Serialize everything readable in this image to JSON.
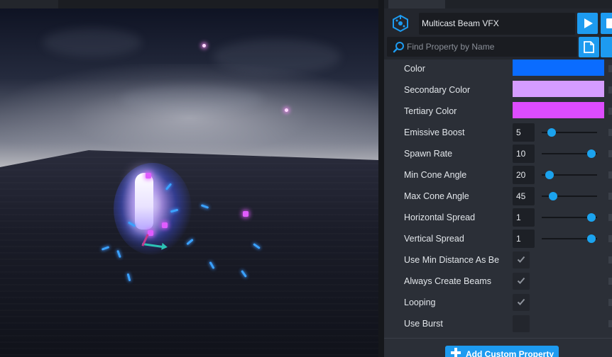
{
  "header": {
    "vfx_name": "Multicast Beam VFX",
    "search_placeholder": "Find Property by Name"
  },
  "properties": [
    {
      "label": "Color",
      "kind": "color",
      "value": "#0a6cff"
    },
    {
      "label": "Secondary Color",
      "kind": "color",
      "value": "#d59cff"
    },
    {
      "label": "Tertiary Color",
      "kind": "color",
      "value": "#dd4cff"
    },
    {
      "label": "Emissive Boost",
      "kind": "slider",
      "value": "5",
      "fill": 0.18
    },
    {
      "label": "Spawn Rate",
      "kind": "slider",
      "value": "10",
      "fill": 0.9
    },
    {
      "label": "Min Cone Angle",
      "kind": "slider",
      "value": "20",
      "fill": 0.14
    },
    {
      "label": "Max Cone Angle",
      "kind": "slider",
      "value": "45",
      "fill": 0.21
    },
    {
      "label": "Horizontal Spread",
      "kind": "slider",
      "value": "1",
      "fill": 0.9
    },
    {
      "label": "Vertical Spread",
      "kind": "slider",
      "value": "1",
      "fill": 0.9
    },
    {
      "label": "Use Min Distance As Be",
      "kind": "checkbox",
      "checked": true
    },
    {
      "label": "Always Create Beams",
      "kind": "checkbox",
      "checked": true
    },
    {
      "label": "Looping",
      "kind": "checkbox",
      "checked": true
    },
    {
      "label": "Use Burst",
      "kind": "checkbox",
      "checked": false
    }
  ],
  "footer": {
    "add_custom_label": "Add Custom Property"
  },
  "colors": {
    "accent": "#1d9bf0",
    "panel_bg": "#2b2f37"
  }
}
